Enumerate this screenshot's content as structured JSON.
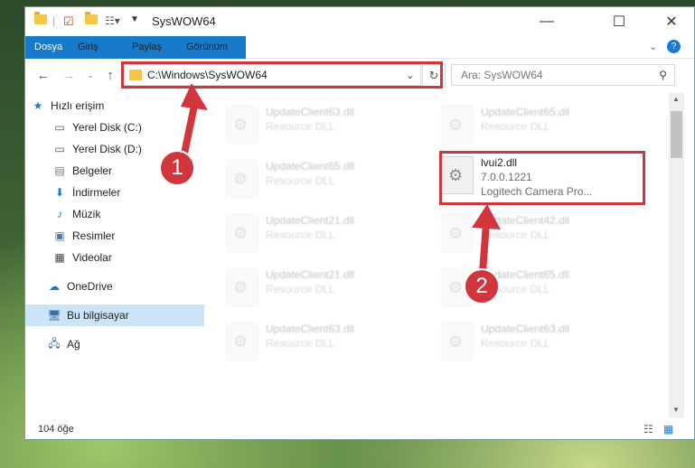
{
  "window": {
    "title": "SysWOW64"
  },
  "ribbon": {
    "tabs": [
      "Dosya",
      "Giriş",
      "Paylaş",
      "Görünüm"
    ]
  },
  "nav": {
    "address": "C:\\Windows\\SysWOW64",
    "search_placeholder": "Ara: SysWOW64"
  },
  "sidebar": {
    "items": [
      {
        "label": "Hızlı erişim",
        "icon": "star-icon"
      },
      {
        "label": "Yerel Disk (C:)",
        "icon": "drive-icon"
      },
      {
        "label": "Yerel Disk (D:)",
        "icon": "drive-icon"
      },
      {
        "label": "Belgeler",
        "icon": "documents-icon"
      },
      {
        "label": "İndirmeler",
        "icon": "download-icon"
      },
      {
        "label": "Müzik",
        "icon": "music-icon"
      },
      {
        "label": "Resimler",
        "icon": "pictures-icon"
      },
      {
        "label": "Videolar",
        "icon": "video-icon"
      },
      {
        "label": "OneDrive",
        "icon": "cloud-icon"
      },
      {
        "label": "Bu bilgisayar",
        "icon": "computer-icon"
      },
      {
        "label": "Ağ",
        "icon": "network-icon"
      }
    ]
  },
  "files": [
    {
      "name": "UpdateClient63.dll",
      "type": "Resource DLL"
    },
    {
      "name": "UpdateClient65.dll",
      "type": "Resource DLL"
    },
    {
      "name": "UpdateClient65.dll",
      "type": "Resource DLL"
    },
    {
      "name": "lvui2.dll",
      "version": "7.0.0.1221",
      "description": "Logitech Camera Pro..."
    },
    {
      "name": "UpdateClient21.dll",
      "type": "Resource DLL"
    },
    {
      "name": "UpdateClient42.dll",
      "type": "Resource DLL"
    },
    {
      "name": "UpdateClient21.dll",
      "type": "Resource DLL"
    },
    {
      "name": "UpdateClient65.dll",
      "type": "Resource DLL"
    },
    {
      "name": "UpdateClient63.dll",
      "type": "Resource DLL"
    },
    {
      "name": "UpdateClient63.dll",
      "type": "Resource DLL"
    }
  ],
  "status": {
    "count": "104 öğe"
  },
  "badges": {
    "one": "1",
    "two": "2"
  },
  "colors": {
    "accent": "#1979ca",
    "highlight": "#d2363d",
    "selected": "#cce4f7"
  }
}
